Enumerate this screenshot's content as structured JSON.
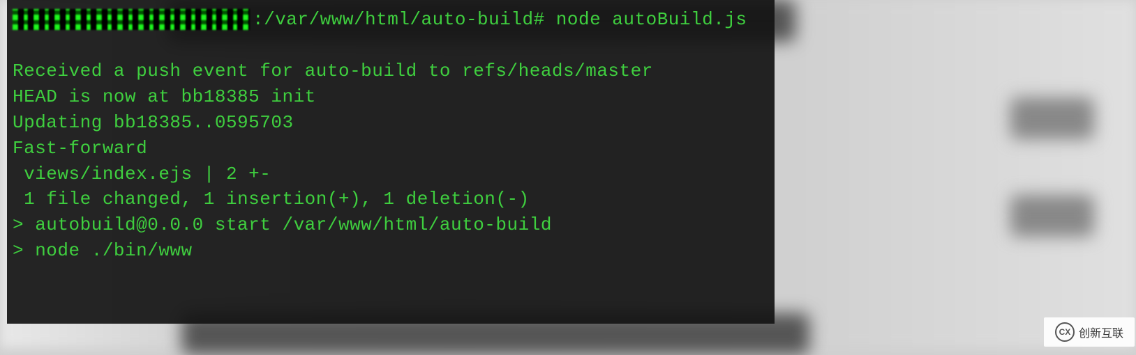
{
  "terminal": {
    "prompt_path": ":/var/www/html/auto-build#",
    "prompt_command": " node autoBuild.js",
    "lines": [
      "Received a push event for auto-build to refs/heads/master",
      "HEAD is now at bb18385 init",
      "Updating bb18385..0595703",
      "Fast-forward",
      " views/index.ejs | 2 +-",
      " 1 file changed, 1 insertion(+), 1 deletion(-)",
      "",
      "> autobuild@0.0.0 start /var/www/html/auto-build",
      "> node ./bin/www"
    ]
  },
  "watermark": {
    "text": "创新互联"
  }
}
